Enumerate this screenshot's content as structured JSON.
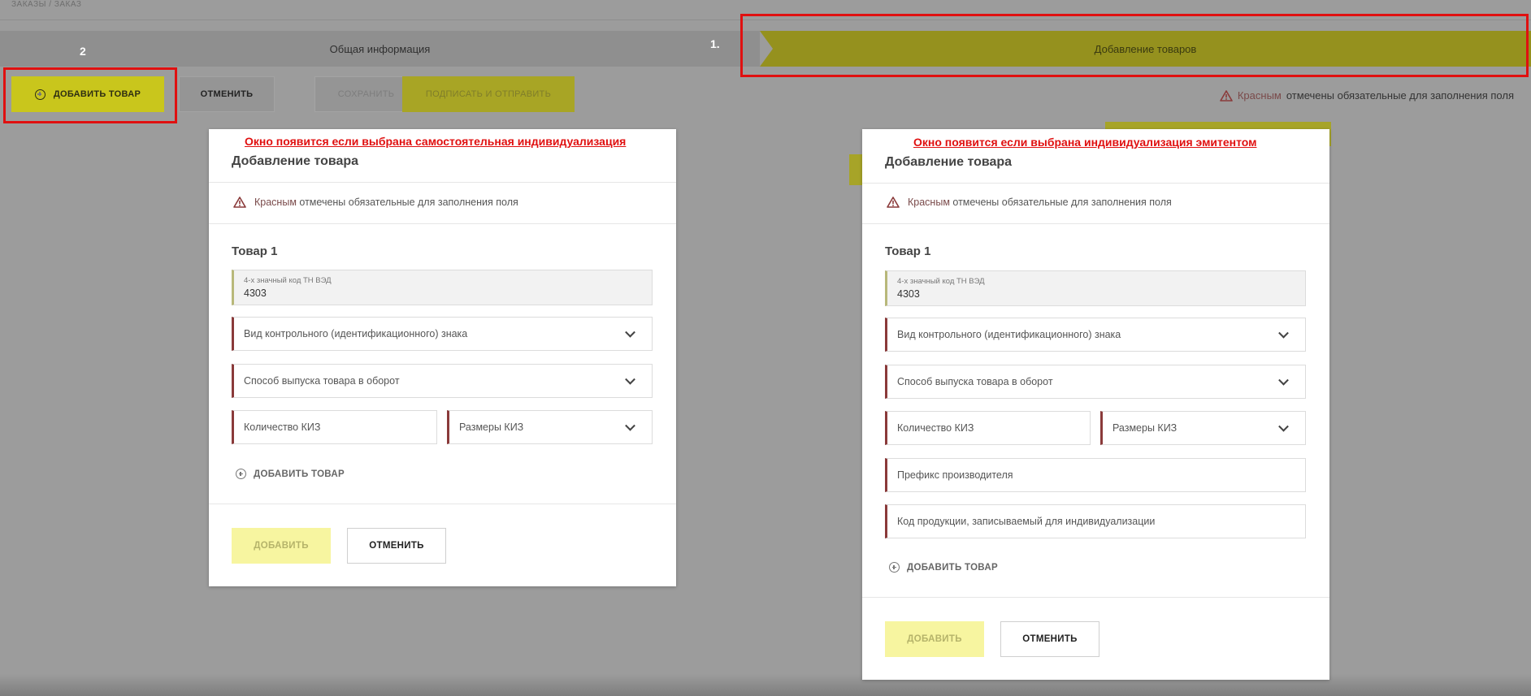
{
  "breadcrumb": "ЗАКАЗЫ  /  ЗАКАЗ",
  "steps": {
    "step1": "Общая информация",
    "step2": "Добавление товаров"
  },
  "annotations": {
    "marker1": "1.",
    "marker2": "2"
  },
  "toolbar": {
    "add_item": "ДОБАВИТЬ ТОВАР",
    "cancel": "ОТМЕНИТЬ",
    "save": "СОХРАНИТЬ",
    "sign_send": "ПОДПИСАТЬ И ОТПРАВИТЬ"
  },
  "required_note": {
    "red_word": "Красным",
    "rest": "отмечены обязательные для заполнения поля"
  },
  "colors": {
    "accent": "#f4f01c",
    "required_marker": "#8a3a3a",
    "annotation_red": "#e01010"
  },
  "modal_left": {
    "caption": "Окно появится если выбрана самостоятельная индивидуализация",
    "title": "Добавление товара",
    "note_red": "Красным",
    "note_rest": "отмечены обязательные для заполнения поля",
    "item_title": "Товар 1",
    "tnved_label": "4-х значный код ТН ВЭД",
    "tnved_value": "4303",
    "sign_type": "Вид контрольного (идентификационного) знака",
    "release_method": "Способ выпуска товара в оборот",
    "kiz_qty": "Количество КИЗ",
    "kiz_size": "Размеры КИЗ",
    "add_item": "ДОБАВИТЬ ТОВАР",
    "btn_add": "ДОБАВИТЬ",
    "btn_cancel": "ОТМЕНИТЬ"
  },
  "modal_right": {
    "caption": "Окно появится если выбрана индивидуализация эмитентом",
    "title": "Добавление товара",
    "note_red": "Красным",
    "note_rest": "отмечены обязательные для заполнения поля",
    "item_title": "Товар 1",
    "tnved_label": "4-х значный код ТН ВЭД",
    "tnved_value": "4303",
    "sign_type": "Вид контрольного (идентификационного) знака",
    "release_method": "Способ выпуска товара в оборот",
    "kiz_qty": "Количество КИЗ",
    "kiz_size": "Размеры КИЗ",
    "prefix": "Префикс производителя",
    "product_code": "Код продукции, записываемый для индивидуализации",
    "add_item": "ДОБАВИТЬ ТОВАР",
    "btn_add": "ДОБАВИТЬ",
    "btn_cancel": "ОТМЕНИТЬ"
  }
}
